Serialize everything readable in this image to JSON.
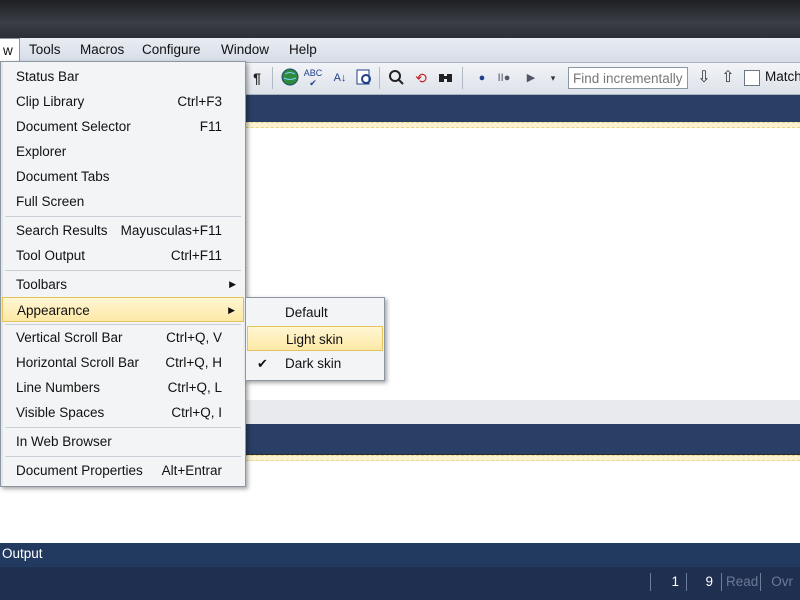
{
  "menubar": {
    "items": [
      {
        "label": "w"
      },
      {
        "label": "Tools"
      },
      {
        "label": "Macros"
      },
      {
        "label": "Configure"
      },
      {
        "label": "Window"
      },
      {
        "label": "Help"
      }
    ]
  },
  "toolbar": {
    "icons": [
      "pilcrow-icon",
      "globe-icon",
      "spellcheck-icon",
      "sort-icon",
      "find-in-files-icon",
      "find-icon",
      "replace-icon",
      "binoculars-icon",
      "record-macro-icon",
      "stop-macro-icon",
      "play-macro-icon",
      "overflow-icon"
    ],
    "find_placeholder": "Find incrementally",
    "match_label": "Match"
  },
  "view_menu": {
    "items": [
      {
        "label": "Status Bar",
        "shortcut": ""
      },
      {
        "label": "Clip Library",
        "shortcut": "Ctrl+F3"
      },
      {
        "label": "Document Selector",
        "shortcut": "F11"
      },
      {
        "label": "Explorer",
        "shortcut": ""
      },
      {
        "label": "Document Tabs",
        "shortcut": ""
      },
      {
        "label": "Full Screen",
        "shortcut": ""
      },
      {
        "label": "Search Results",
        "shortcut": "Mayusculas+F11"
      },
      {
        "label": "Tool Output",
        "shortcut": "Ctrl+F11"
      },
      {
        "label": "Toolbars",
        "shortcut": ""
      },
      {
        "label": "Appearance",
        "shortcut": ""
      },
      {
        "label": "Vertical Scroll Bar",
        "shortcut": "Ctrl+Q, V"
      },
      {
        "label": "Horizontal Scroll Bar",
        "shortcut": "Ctrl+Q, H"
      },
      {
        "label": "Line Numbers",
        "shortcut": "Ctrl+Q, L"
      },
      {
        "label": "Visible Spaces",
        "shortcut": "Ctrl+Q, I"
      },
      {
        "label": "In Web Browser",
        "shortcut": ""
      },
      {
        "label": "Document Properties",
        "shortcut": "Alt+Entrar"
      }
    ]
  },
  "appearance_menu": {
    "items": [
      {
        "label": "Default",
        "checked": false
      },
      {
        "label": "Light skin",
        "checked": false
      },
      {
        "label": "Dark skin",
        "checked": true
      }
    ],
    "check_glyph": "✔"
  },
  "output": {
    "label": "Output"
  },
  "status": {
    "line": "1",
    "col": "9",
    "read": "Read",
    "ovr": "Ovr"
  },
  "colors": {
    "highlight": "#fde9a6",
    "navy": "#2a3f66",
    "status": "#1f2f4f"
  }
}
